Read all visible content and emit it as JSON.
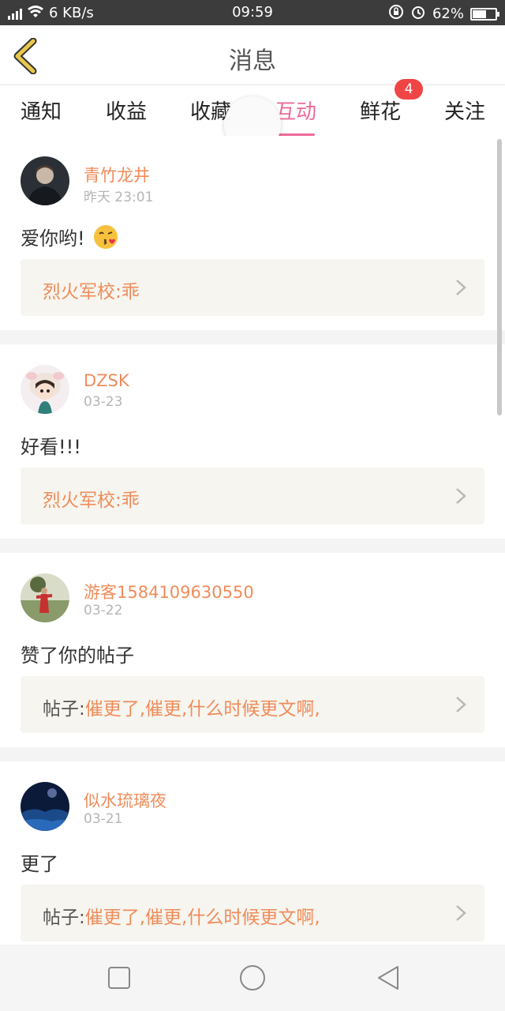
{
  "statusbar": {
    "net_speed": "6 KB/s",
    "time": "09:59",
    "battery": "62%",
    "battery_level": 0.62,
    "icons": [
      "signal-icon",
      "wifi-icon",
      "lock-rotation-icon",
      "alarm-icon",
      "battery-icon"
    ]
  },
  "header": {
    "title": "消息",
    "back_icon": "chevron-left-icon"
  },
  "tabs": [
    {
      "label": "通知"
    },
    {
      "label": "收益"
    },
    {
      "label": "收藏"
    },
    {
      "label": "互动",
      "active": true
    },
    {
      "label": "鲜花",
      "badge": "4"
    },
    {
      "label": "关注"
    }
  ],
  "items": [
    {
      "name": "青竹龙井",
      "time": "昨天 23:01",
      "message": "爱你哟!",
      "quote_prefix": "",
      "quote": "烈火军校:乖"
    },
    {
      "name": "DZSK",
      "time": "03-23",
      "message": "好看!!!",
      "quote_prefix": "",
      "quote": "烈火军校:乖"
    },
    {
      "name": "游客1584109630550",
      "time": "03-22",
      "message": "赞了你的帖子",
      "quote_prefix": "帖子:",
      "quote": "催更了,催更,什么时候更文啊,"
    },
    {
      "name": "似水琉璃夜",
      "time": "03-21",
      "message": "更了",
      "quote_prefix": "帖子:",
      "quote": "催更了,催更,什么时候更文啊,"
    }
  ],
  "colors": {
    "accent": "#ee6a9a",
    "name": "#ef8c5a",
    "badge": "#f04545",
    "back_arrow": "#e8c84a"
  }
}
